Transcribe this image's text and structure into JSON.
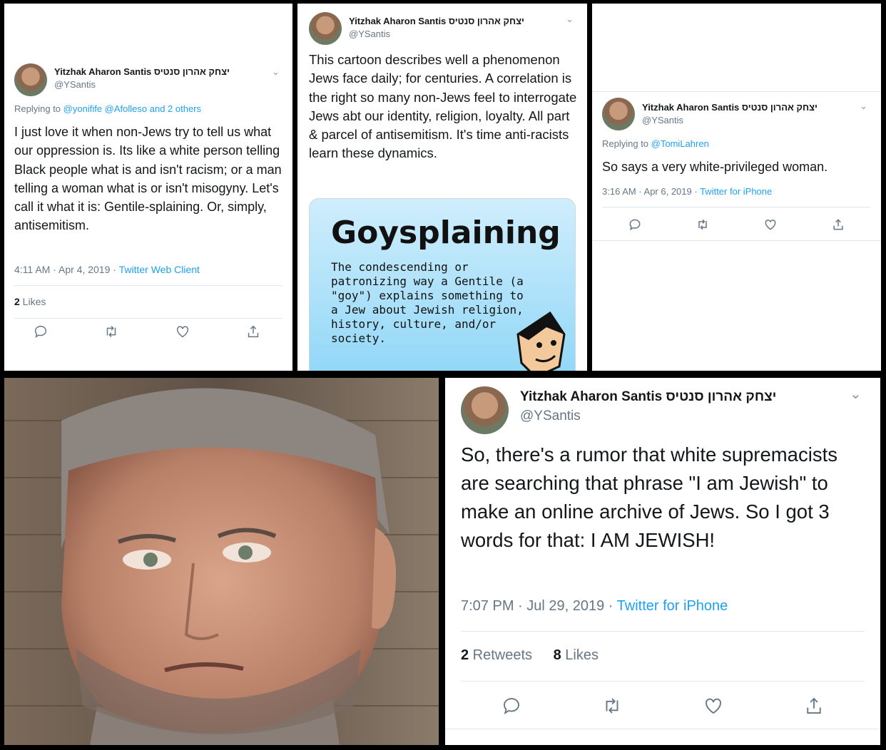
{
  "panel1": {
    "name": "Yitzhak Aharon Santis יצחק אהרון סנטיס",
    "handle": "@YSantis",
    "replying_prefix": "Replying to",
    "replying_links": "@yonifife @Afolleso and 2 others",
    "text": "I just love it when non-Jews try to tell us what our oppression is. Its like a white person telling Black people what is and isn't racism; or a man telling a woman what is or isn't misogyny. Let's call it what it is: Gentile-splaining. Or, simply, antisemitism.",
    "time": "4:11 AM · Apr 4, 2019 · ",
    "source": "Twitter Web Client",
    "likes_count": "2",
    "likes_label": " Likes"
  },
  "panel2": {
    "name": "Yitzhak Aharon Santis יצחק אהרון סנטיס",
    "handle": "@YSantis",
    "text": "This cartoon describes well a phenomenon Jews face daily; for centuries. A correlation is the right so many non-Jews feel to interrogate Jews abt our identity, religion, loyalty. All part & parcel of antisemitism. It's time anti-racists learn these dynamics.",
    "cartoon_title": "Goysplaining",
    "cartoon_body": "The condescending or patronizing way a Gentile (a \"goy\") explains something to a Jew about Jewish religion, history, culture, and/or society."
  },
  "panel3": {
    "name": "Yitzhak Aharon Santis יצחק אהרון סנטיס",
    "handle": "@YSantis",
    "replying_prefix": "Replying to",
    "replying_links": "@TomiLahren",
    "text": "So says a very white-privileged woman.",
    "time": "3:16 AM · Apr 6, 2019 · ",
    "source": "Twitter for iPhone"
  },
  "panel5": {
    "name": "Yitzhak Aharon Santis יצחק אהרון סנטיס",
    "handle": "@YSantis",
    "text": "So, there's a rumor that white supremacists are searching that phrase \"I am Jewish\" to make an online archive of Jews. So I got 3 words for that: I AM JEWISH!",
    "time": "7:07 PM · Jul 29, 2019 · ",
    "source": "Twitter for iPhone",
    "retweets_count": "2",
    "retweets_label": " Retweets",
    "likes_count": "8",
    "likes_label": " Likes"
  },
  "icons": [
    "reply-icon",
    "retweet-icon",
    "like-icon",
    "share-icon",
    "chevron-down-icon"
  ],
  "colors": {
    "link": "#1da1f2",
    "muted": "#657786",
    "text": "#14171a",
    "divider": "#e1e8ed"
  }
}
